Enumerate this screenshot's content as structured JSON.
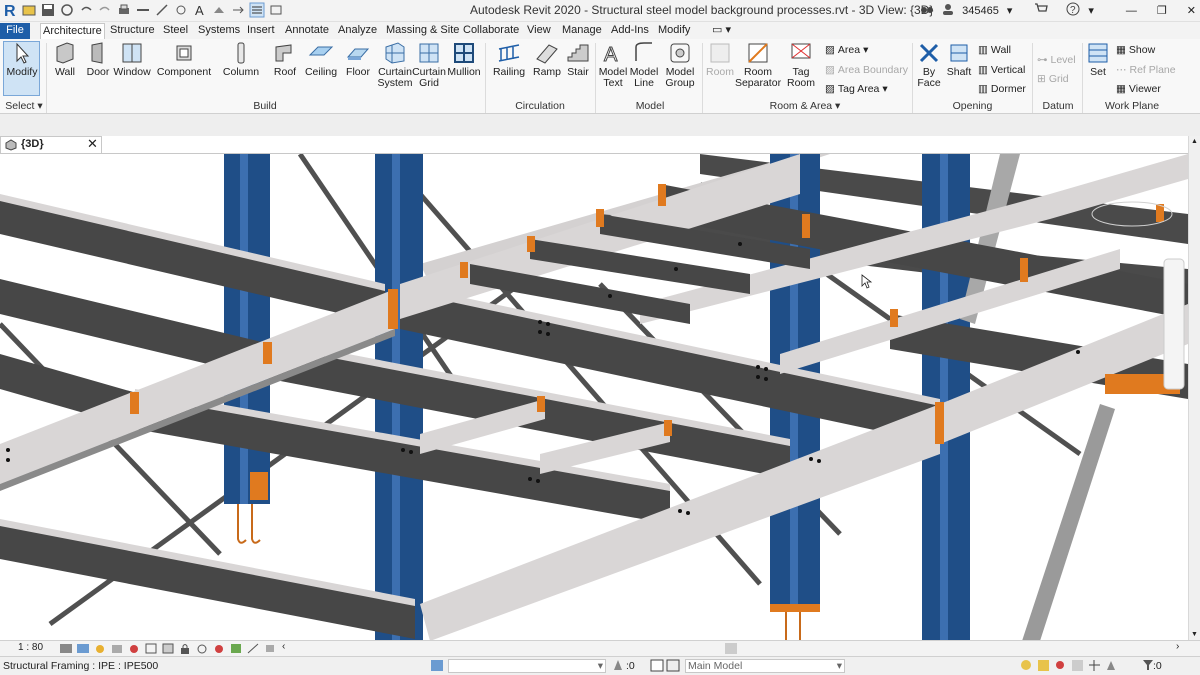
{
  "titlebar": {
    "title": "Autodesk Revit 2020 - Structural steel model background processes.rvt - 3D View: {3D}",
    "user": "345465"
  },
  "tabs": [
    "File",
    "Architecture",
    "Structure",
    "Steel",
    "Systems",
    "Insert",
    "Annotate",
    "Analyze",
    "Massing & Site",
    "Collaborate",
    "View",
    "Manage",
    "Add-Ins",
    "Modify"
  ],
  "ribbon": {
    "modify": "Modify",
    "select": "Select",
    "build": [
      "Wall",
      "Door",
      "Window",
      "Component",
      "Column",
      "Roof",
      "Ceiling",
      "Floor",
      "Curtain System",
      "Curtain Grid",
      "Mullion"
    ],
    "circulation": [
      "Railing",
      "Ramp",
      "Stair"
    ],
    "model": [
      "Model Text",
      "Model Line",
      "Model Group"
    ],
    "room": [
      "Room",
      "Room Separator",
      "Tag Room"
    ],
    "area": [
      "Area",
      "Area Boundary",
      "Tag Area"
    ],
    "opening": {
      "big": [
        "By Face",
        "Shaft"
      ],
      "small": [
        "Wall",
        "Vertical",
        "Dormer"
      ]
    },
    "datum": [
      "Level",
      "Grid"
    ],
    "workplane": {
      "big": "Set",
      "small": [
        "Show",
        "Ref Plane",
        "Viewer"
      ]
    },
    "panels": {
      "build": "Build",
      "circulation": "Circulation",
      "model": "Model",
      "room": "Room & Area",
      "opening": "Opening",
      "datum": "Datum",
      "workplane": "Work Plane"
    }
  },
  "view_tab": {
    "label": "{3D}"
  },
  "viewctrl": {
    "scale": "1 : 80"
  },
  "status": {
    "text": "Structural Framing : IPE : IPE500",
    "workset": "Main Model",
    "count1": ":0",
    "count2": ":0"
  },
  "colors": {
    "column": "#1f4e87",
    "beam_top": "#d9d6d6",
    "beam_web": "#4a4a4a",
    "plate": "#e07a1f",
    "accent": "#1e5ea8"
  }
}
